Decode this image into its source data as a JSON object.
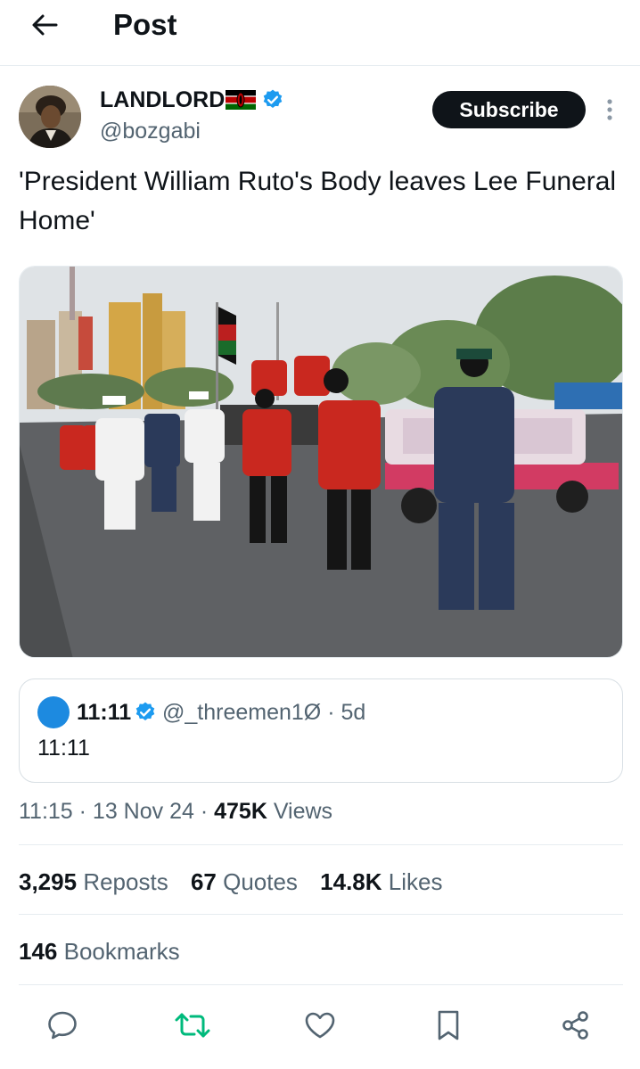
{
  "header": {
    "title": "Post",
    "back_icon": "arrow-left-icon"
  },
  "post": {
    "author": {
      "display_name": "LANDLORD",
      "flag": "kenya-flag",
      "verified": true,
      "handle": "@bozgabi"
    },
    "subscribe_label": "Subscribe",
    "more_icon": "more-vertical-icon",
    "text": "'President William Ruto's Body leaves Lee Funeral Home'",
    "media": {
      "type": "photo"
    },
    "quoted": {
      "display_name": "11:11",
      "verified": true,
      "handle_time": "@_threemen1Ø · 5d",
      "text": "11:11"
    },
    "meta": {
      "time_date": "11:15 · 13 Nov 24 · ",
      "views_count": "475K",
      "views_label": " Views"
    },
    "stats": {
      "reposts_count": "3,295",
      "reposts_label": "Reposts",
      "quotes_count": "67",
      "quotes_label": "Quotes",
      "likes_count": "14.8K",
      "likes_label": "Likes",
      "bookmarks_count": "146",
      "bookmarks_label": "Bookmarks"
    },
    "actions": [
      "reply-icon",
      "repost-icon",
      "like-icon",
      "bookmark-icon",
      "share-icon"
    ]
  },
  "colors": {
    "verified_blue": "#1d9bf0",
    "repost_green": "#00ba7c",
    "text_primary": "#0f1419",
    "text_secondary": "#536471"
  }
}
